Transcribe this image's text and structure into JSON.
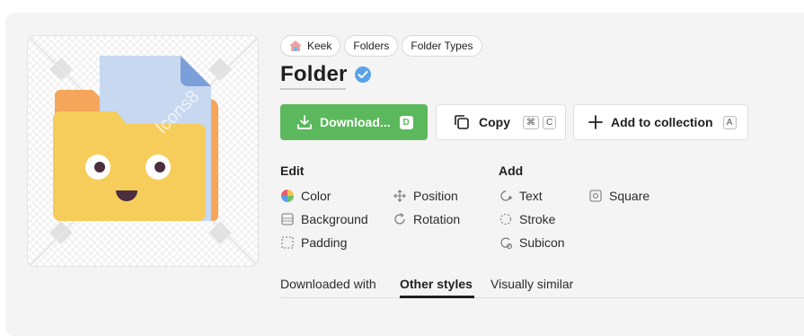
{
  "breadcrumbs": [
    {
      "label": "Keek",
      "icon": "house-icon"
    },
    {
      "label": "Folders"
    },
    {
      "label": "Folder Types"
    }
  ],
  "icon_title": "Folder",
  "verified_icon": "verified-badge-icon",
  "preview": {
    "watermark": "Icons8"
  },
  "actions": {
    "download": {
      "label": "Download...",
      "shortcut": "D"
    },
    "copy": {
      "label": "Copy",
      "shortcut": [
        "⌘",
        "C"
      ]
    },
    "add_collection": {
      "label": "Add to collection",
      "shortcut": "A"
    }
  },
  "edit": {
    "title": "Edit",
    "options": [
      "Color",
      "Position",
      "Background",
      "Rotation",
      "Padding"
    ]
  },
  "add": {
    "title": "Add",
    "options": [
      "Text",
      "Square",
      "Stroke",
      "Subicon"
    ]
  },
  "tabs": [
    "Downloaded with",
    "Other styles",
    "Visually similar"
  ],
  "active_tab": "Other styles",
  "colors": {
    "download_green": "#5cb85c",
    "folder_yellow": "#f6cd5b",
    "folder_back_orange": "#f5a65b",
    "paper_blue": "#c7d8f0"
  }
}
